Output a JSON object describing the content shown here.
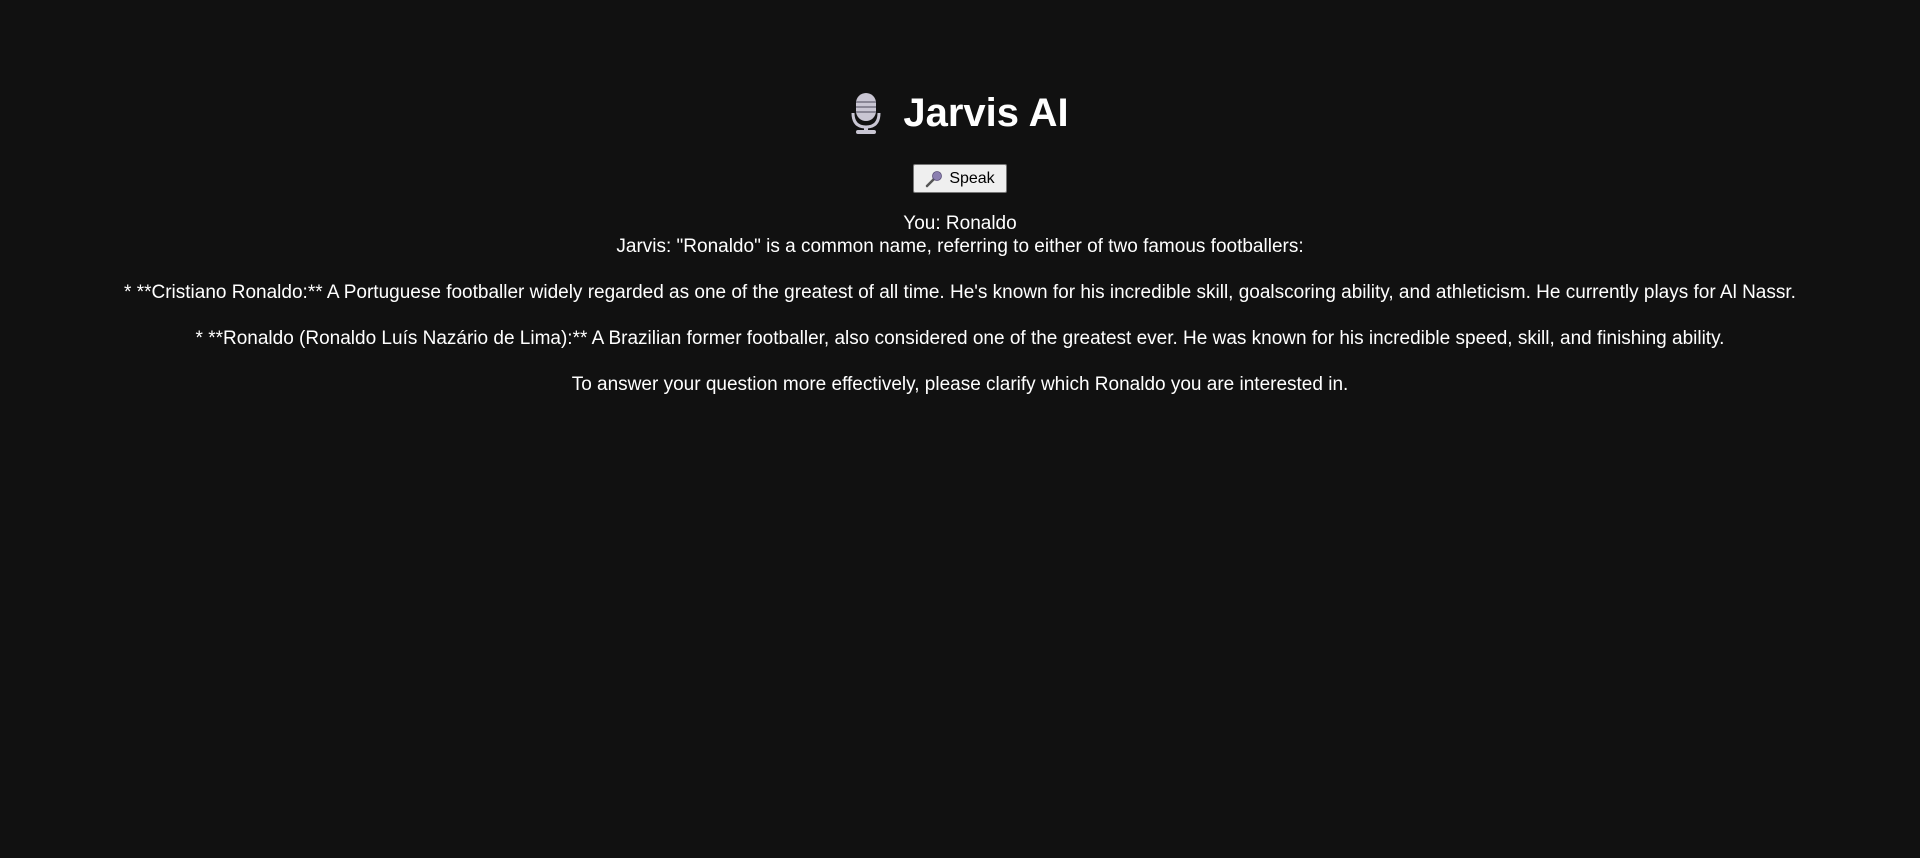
{
  "app": {
    "title": "Jarvis AI",
    "title_icon": "microphone-icon"
  },
  "controls": {
    "speak_label": "Speak",
    "speak_icon": "microphone-icon"
  },
  "conversation": {
    "user_line": "You: Ronaldo",
    "assistant_intro": "Jarvis: \"Ronaldo\" is a common name, referring to either of two famous footballers:",
    "bullet_1": "* **Cristiano Ronaldo:** A Portuguese footballer widely regarded as one of the greatest of all time. He's known for his incredible skill, goalscoring ability, and athleticism. He currently plays for Al Nassr.",
    "bullet_2": "* **Ronaldo (Ronaldo Luís Nazário de Lima):** A Brazilian former footballer, also considered one of the greatest ever. He was known for his incredible speed, skill, and finishing ability.",
    "closing": "To answer your question more effectively, please clarify which Ronaldo you are interested in."
  },
  "colors": {
    "background": "#111111",
    "text": "#ffffff",
    "button_bg": "#efefef"
  }
}
